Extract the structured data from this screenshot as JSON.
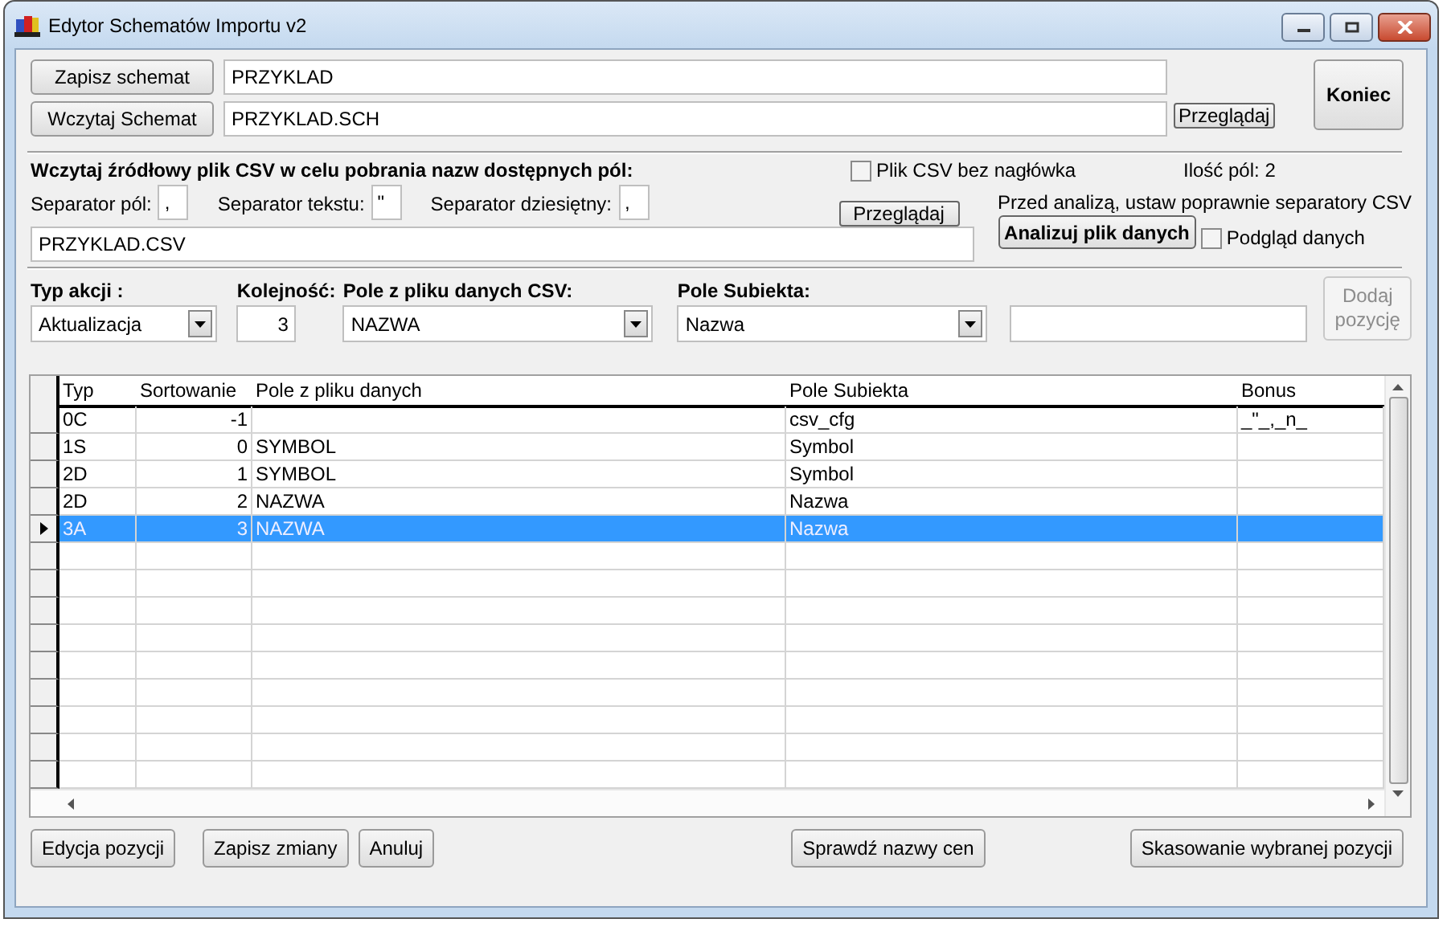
{
  "window": {
    "title": "Edytor Schematów Importu v2"
  },
  "schema": {
    "save_button": "Zapisz schemat",
    "save_name": "PRZYKLAD",
    "load_button": "Wczytaj Schemat",
    "load_path": "PRZYKLAD.SCH",
    "browse_button": "Przeglądaj"
  },
  "exit_button": "Koniec",
  "csv": {
    "heading": "Wczytaj źródłowy plik CSV w celu pobrania nazw dostępnych pól:",
    "no_header": {
      "label": "Plik CSV bez nagłówka",
      "checked": false
    },
    "field_count": "Ilość pól: 2",
    "separators": [
      {
        "label": "Separator pól:",
        "value": ","
      },
      {
        "label": "Separator tekstu:",
        "value": "\""
      },
      {
        "label": "Separator dziesiętny:",
        "value": ","
      }
    ],
    "browse_button": "Przeglądaj",
    "hint": "Przed analizą, ustaw poprawnie separatory CSV",
    "path": "PRZYKLAD.CSV",
    "analyze_button": "Analizuj plik danych",
    "preview": {
      "label": "Podgląd danych",
      "checked": false
    }
  },
  "entry": {
    "fields": [
      {
        "kind": "combo",
        "label": "Typ akcji :",
        "value": "Aktualizacja"
      },
      {
        "kind": "number",
        "label": "Kolejność:",
        "value": "3"
      },
      {
        "kind": "combo",
        "label": "Pole z pliku danych CSV:",
        "value": "NAZWA"
      },
      {
        "kind": "combo",
        "label": "Pole Subiekta:",
        "value": "Nazwa"
      },
      {
        "kind": "text"
      }
    ],
    "add_button": {
      "label": "Dodaj pozycję",
      "disabled": true
    }
  },
  "table": {
    "columns": [
      "Typ",
      "Sortowanie",
      "Pole z pliku danych",
      "Pole Subiekta",
      "Bonus"
    ],
    "rows": [
      {
        "cells": [
          "0C",
          "-1",
          "",
          "csv_cfg",
          "_\"_,_n_"
        ],
        "selected": false
      },
      {
        "cells": [
          "1S",
          "0",
          "SYMBOL",
          "Symbol",
          ""
        ],
        "selected": false
      },
      {
        "cells": [
          "2D",
          "1",
          "SYMBOL",
          "Symbol",
          ""
        ],
        "selected": false
      },
      {
        "cells": [
          "2D",
          "2",
          "NAZWA",
          "Nazwa",
          ""
        ],
        "selected": false
      },
      {
        "cells": [
          "3A",
          "3",
          "NAZWA",
          "Nazwa",
          ""
        ],
        "selected": true
      }
    ]
  },
  "buttons": [
    "Edycja pozycji",
    "Zapisz zmiany",
    "Anuluj",
    "Sprawdź nazwy cen",
    "Skasowanie wybranej pozycji"
  ]
}
